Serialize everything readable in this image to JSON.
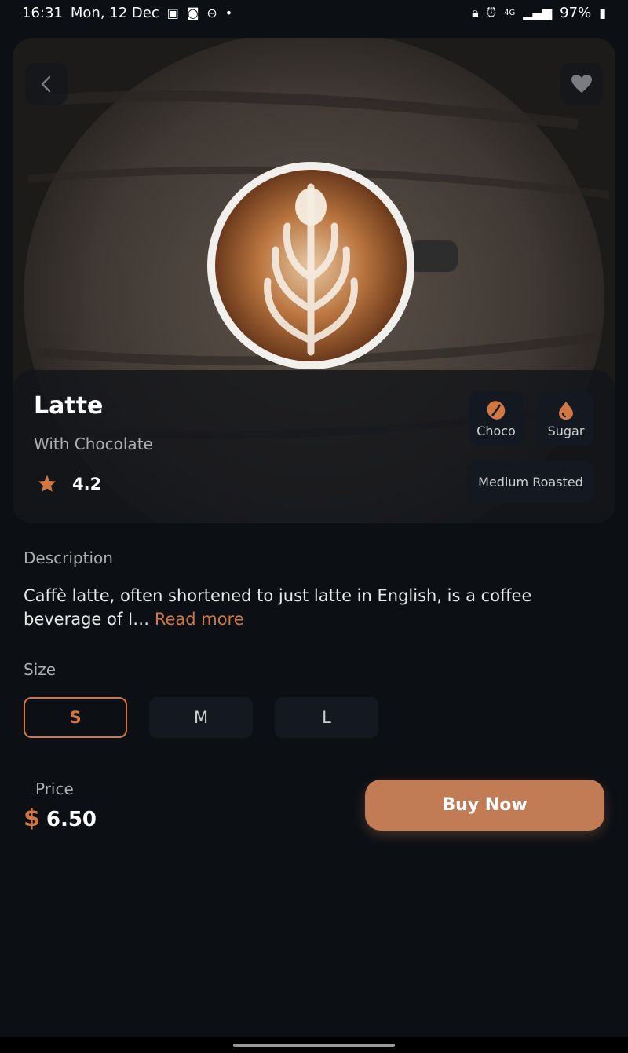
{
  "status_bar": {
    "time": "16:31",
    "date": "Mon, 12 Dec",
    "network": "4G",
    "battery": "97%"
  },
  "product": {
    "name": "Latte",
    "subtitle": "With Chocolate",
    "rating": "4.2",
    "ingredients": [
      {
        "label": "Choco",
        "icon": "coffee-bean-icon"
      },
      {
        "label": "Sugar",
        "icon": "drop-icon"
      }
    ],
    "roast": "Medium Roasted"
  },
  "description": {
    "title": "Description",
    "text": "Caffè latte, often shortened to just latte in English, is a coffee beverage of I… ",
    "read_more": "Read more"
  },
  "size": {
    "title": "Size",
    "options": [
      "S",
      "M",
      "L"
    ],
    "selected": "S"
  },
  "price": {
    "label": "Price",
    "currency": "$",
    "value": "6.50"
  },
  "buy_button": "Buy Now",
  "colors": {
    "background": "#0c0f14",
    "accent": "#d17842",
    "button": "#c17c56",
    "chip": "#141821"
  }
}
